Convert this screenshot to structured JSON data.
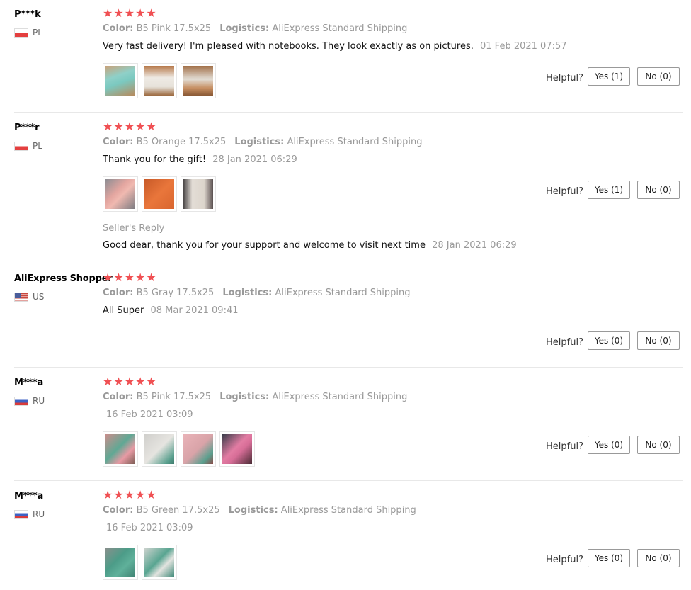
{
  "labels": {
    "color": "Color:",
    "logistics": "Logistics:",
    "helpful": "Helpful?",
    "seller_reply": "Seller's Reply"
  },
  "star_color": "#f05053",
  "reviews": [
    {
      "name": "P***k",
      "country": "PL",
      "stars": "★★★★★",
      "color": "B5 Pink 17.5x25",
      "logistics": "AliExpress Standard Shipping",
      "text": "Very fast delivery! I'm pleased with notebooks. They look exactly as on pictures.",
      "date": "01 Feb 2021 07:57",
      "yes": "Yes (1)",
      "no": "No (0)",
      "photos": [
        "photo-teal-notebook",
        "photo-notebook-opened",
        "photo-notebook-cover"
      ]
    },
    {
      "name": "P***r",
      "country": "PL",
      "stars": "★★★★★",
      "color": "B5 Orange 17.5x25",
      "logistics": "AliExpress Standard Shipping",
      "text": "Thank you for the gift!",
      "date": "28 Jan 2021 06:29",
      "yes": "Yes (1)",
      "no": "No (0)",
      "photos": [
        "photo-package",
        "photo-orange-notebook",
        "photo-open-pages"
      ],
      "reply_text": "Good dear, thank you for your support and welcome to visit next time",
      "reply_date": "28 Jan 2021 06:29"
    },
    {
      "name": "AliExpress Shopper",
      "country": "US",
      "stars": "★★★★★",
      "color": "B5 Gray 17.5x25",
      "logistics": "AliExpress Standard Shipping",
      "text": "All Super",
      "date": "08 Mar 2021 09:41",
      "yes": "Yes (0)",
      "no": "No (0)"
    },
    {
      "name": "M***a",
      "country": "RU",
      "stars": "★★★★★",
      "color": "B5 Pink 17.5x25",
      "logistics": "AliExpress Standard Shipping",
      "text": "",
      "date": "16 Feb 2021 03:09",
      "yes": "Yes (0)",
      "no": "No (0)",
      "photos": [
        "photo-pink-notebook",
        "photo-white-notebook",
        "photo-pink-cover",
        "photo-pink-pen"
      ]
    },
    {
      "name": "M***a",
      "country": "RU",
      "stars": "★★★★★",
      "color": "B5 Green 17.5x25",
      "logistics": "AliExpress Standard Shipping",
      "text": "",
      "date": "16 Feb 2021 03:09",
      "yes": "Yes (0)",
      "no": "No (0)",
      "photos": [
        "photo-green-notebook",
        "photo-green-cover"
      ]
    }
  ]
}
